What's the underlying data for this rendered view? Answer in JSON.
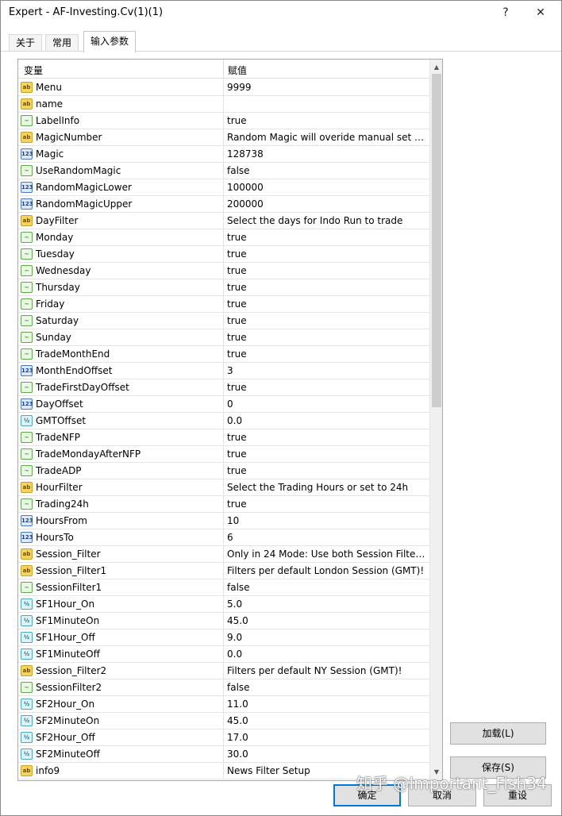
{
  "window": {
    "title": "Expert - AF-Investing.Cv(1)(1)",
    "help": "?",
    "close": "✕"
  },
  "tabs": [
    {
      "label": "关于"
    },
    {
      "label": "常用"
    },
    {
      "label": "输入参数"
    }
  ],
  "grid": {
    "col_variable": "变量",
    "col_value": "赋值",
    "rows": [
      {
        "type": "ab",
        "name": "Menu",
        "value": "9999"
      },
      {
        "type": "ab",
        "name": "name",
        "value": ""
      },
      {
        "type": "bool",
        "name": "LabelInfo",
        "value": "true"
      },
      {
        "type": "ab",
        "name": "MagicNumber",
        "value": "Random Magic will overide manual set Ma..."
      },
      {
        "type": "int",
        "name": "Magic",
        "value": "128738"
      },
      {
        "type": "bool",
        "name": "UseRandomMagic",
        "value": "false"
      },
      {
        "type": "int",
        "name": "RandomMagicLower",
        "value": "100000"
      },
      {
        "type": "int",
        "name": "RandomMagicUpper",
        "value": "200000"
      },
      {
        "type": "ab",
        "name": "DayFilter",
        "value": "Select the days for Indo Run to trade"
      },
      {
        "type": "bool",
        "name": "Monday",
        "value": "true"
      },
      {
        "type": "bool",
        "name": "Tuesday",
        "value": "true"
      },
      {
        "type": "bool",
        "name": "Wednesday",
        "value": "true"
      },
      {
        "type": "bool",
        "name": "Thursday",
        "value": "true"
      },
      {
        "type": "bool",
        "name": "Friday",
        "value": "true"
      },
      {
        "type": "bool",
        "name": "Saturday",
        "value": "true"
      },
      {
        "type": "bool",
        "name": "Sunday",
        "value": "true"
      },
      {
        "type": "bool",
        "name": "TradeMonthEnd",
        "value": "true"
      },
      {
        "type": "int",
        "name": "MonthEndOffset",
        "value": "3"
      },
      {
        "type": "bool",
        "name": "TradeFirstDayOffset",
        "value": "true"
      },
      {
        "type": "int",
        "name": "DayOffset",
        "value": "0"
      },
      {
        "type": "dbl",
        "name": "GMTOffset",
        "value": "0.0"
      },
      {
        "type": "bool",
        "name": "TradeNFP",
        "value": "true"
      },
      {
        "type": "bool",
        "name": "TradeMondayAfterNFP",
        "value": "true"
      },
      {
        "type": "bool",
        "name": "TradeADP",
        "value": "true"
      },
      {
        "type": "ab",
        "name": "HourFilter",
        "value": "Select the Trading Hours or set to 24h"
      },
      {
        "type": "bool",
        "name": "Trading24h",
        "value": "true"
      },
      {
        "type": "int",
        "name": "HoursFrom",
        "value": "10"
      },
      {
        "type": "int",
        "name": "HoursTo",
        "value": "6"
      },
      {
        "type": "ab",
        "name": "Session_Filter",
        "value": "Only in 24 Mode: Use both Session Filter..."
      },
      {
        "type": "ab",
        "name": "Session_Filter1",
        "value": "Filters per default London Session (GMT)!"
      },
      {
        "type": "bool",
        "name": "SessionFilter1",
        "value": "false"
      },
      {
        "type": "dbl",
        "name": "SF1Hour_On",
        "value": "5.0"
      },
      {
        "type": "dbl",
        "name": "SF1MinuteOn",
        "value": "45.0"
      },
      {
        "type": "dbl",
        "name": "SF1Hour_Off",
        "value": "9.0"
      },
      {
        "type": "dbl",
        "name": "SF1MinuteOff",
        "value": "0.0"
      },
      {
        "type": "ab",
        "name": "Session_Filter2",
        "value": "Filters per default NY Session (GMT)!"
      },
      {
        "type": "bool",
        "name": "SessionFilter2",
        "value": "false"
      },
      {
        "type": "dbl",
        "name": "SF2Hour_On",
        "value": "11.0"
      },
      {
        "type": "dbl",
        "name": "SF2MinuteOn",
        "value": "45.0"
      },
      {
        "type": "dbl",
        "name": "SF2Hour_Off",
        "value": "17.0"
      },
      {
        "type": "dbl",
        "name": "SF2MinuteOff",
        "value": "30.0"
      },
      {
        "type": "ab",
        "name": "info9",
        "value": "News Filter Setup"
      }
    ]
  },
  "icons": {
    "ab": "ab",
    "bool": "~",
    "int": "123",
    "dbl": "½"
  },
  "buttons": {
    "load": "加载(L)",
    "save": "保存(S)",
    "ok": "确定",
    "cancel": "取消",
    "reset": "重设"
  },
  "watermark": "知乎 @Important_Fish34"
}
